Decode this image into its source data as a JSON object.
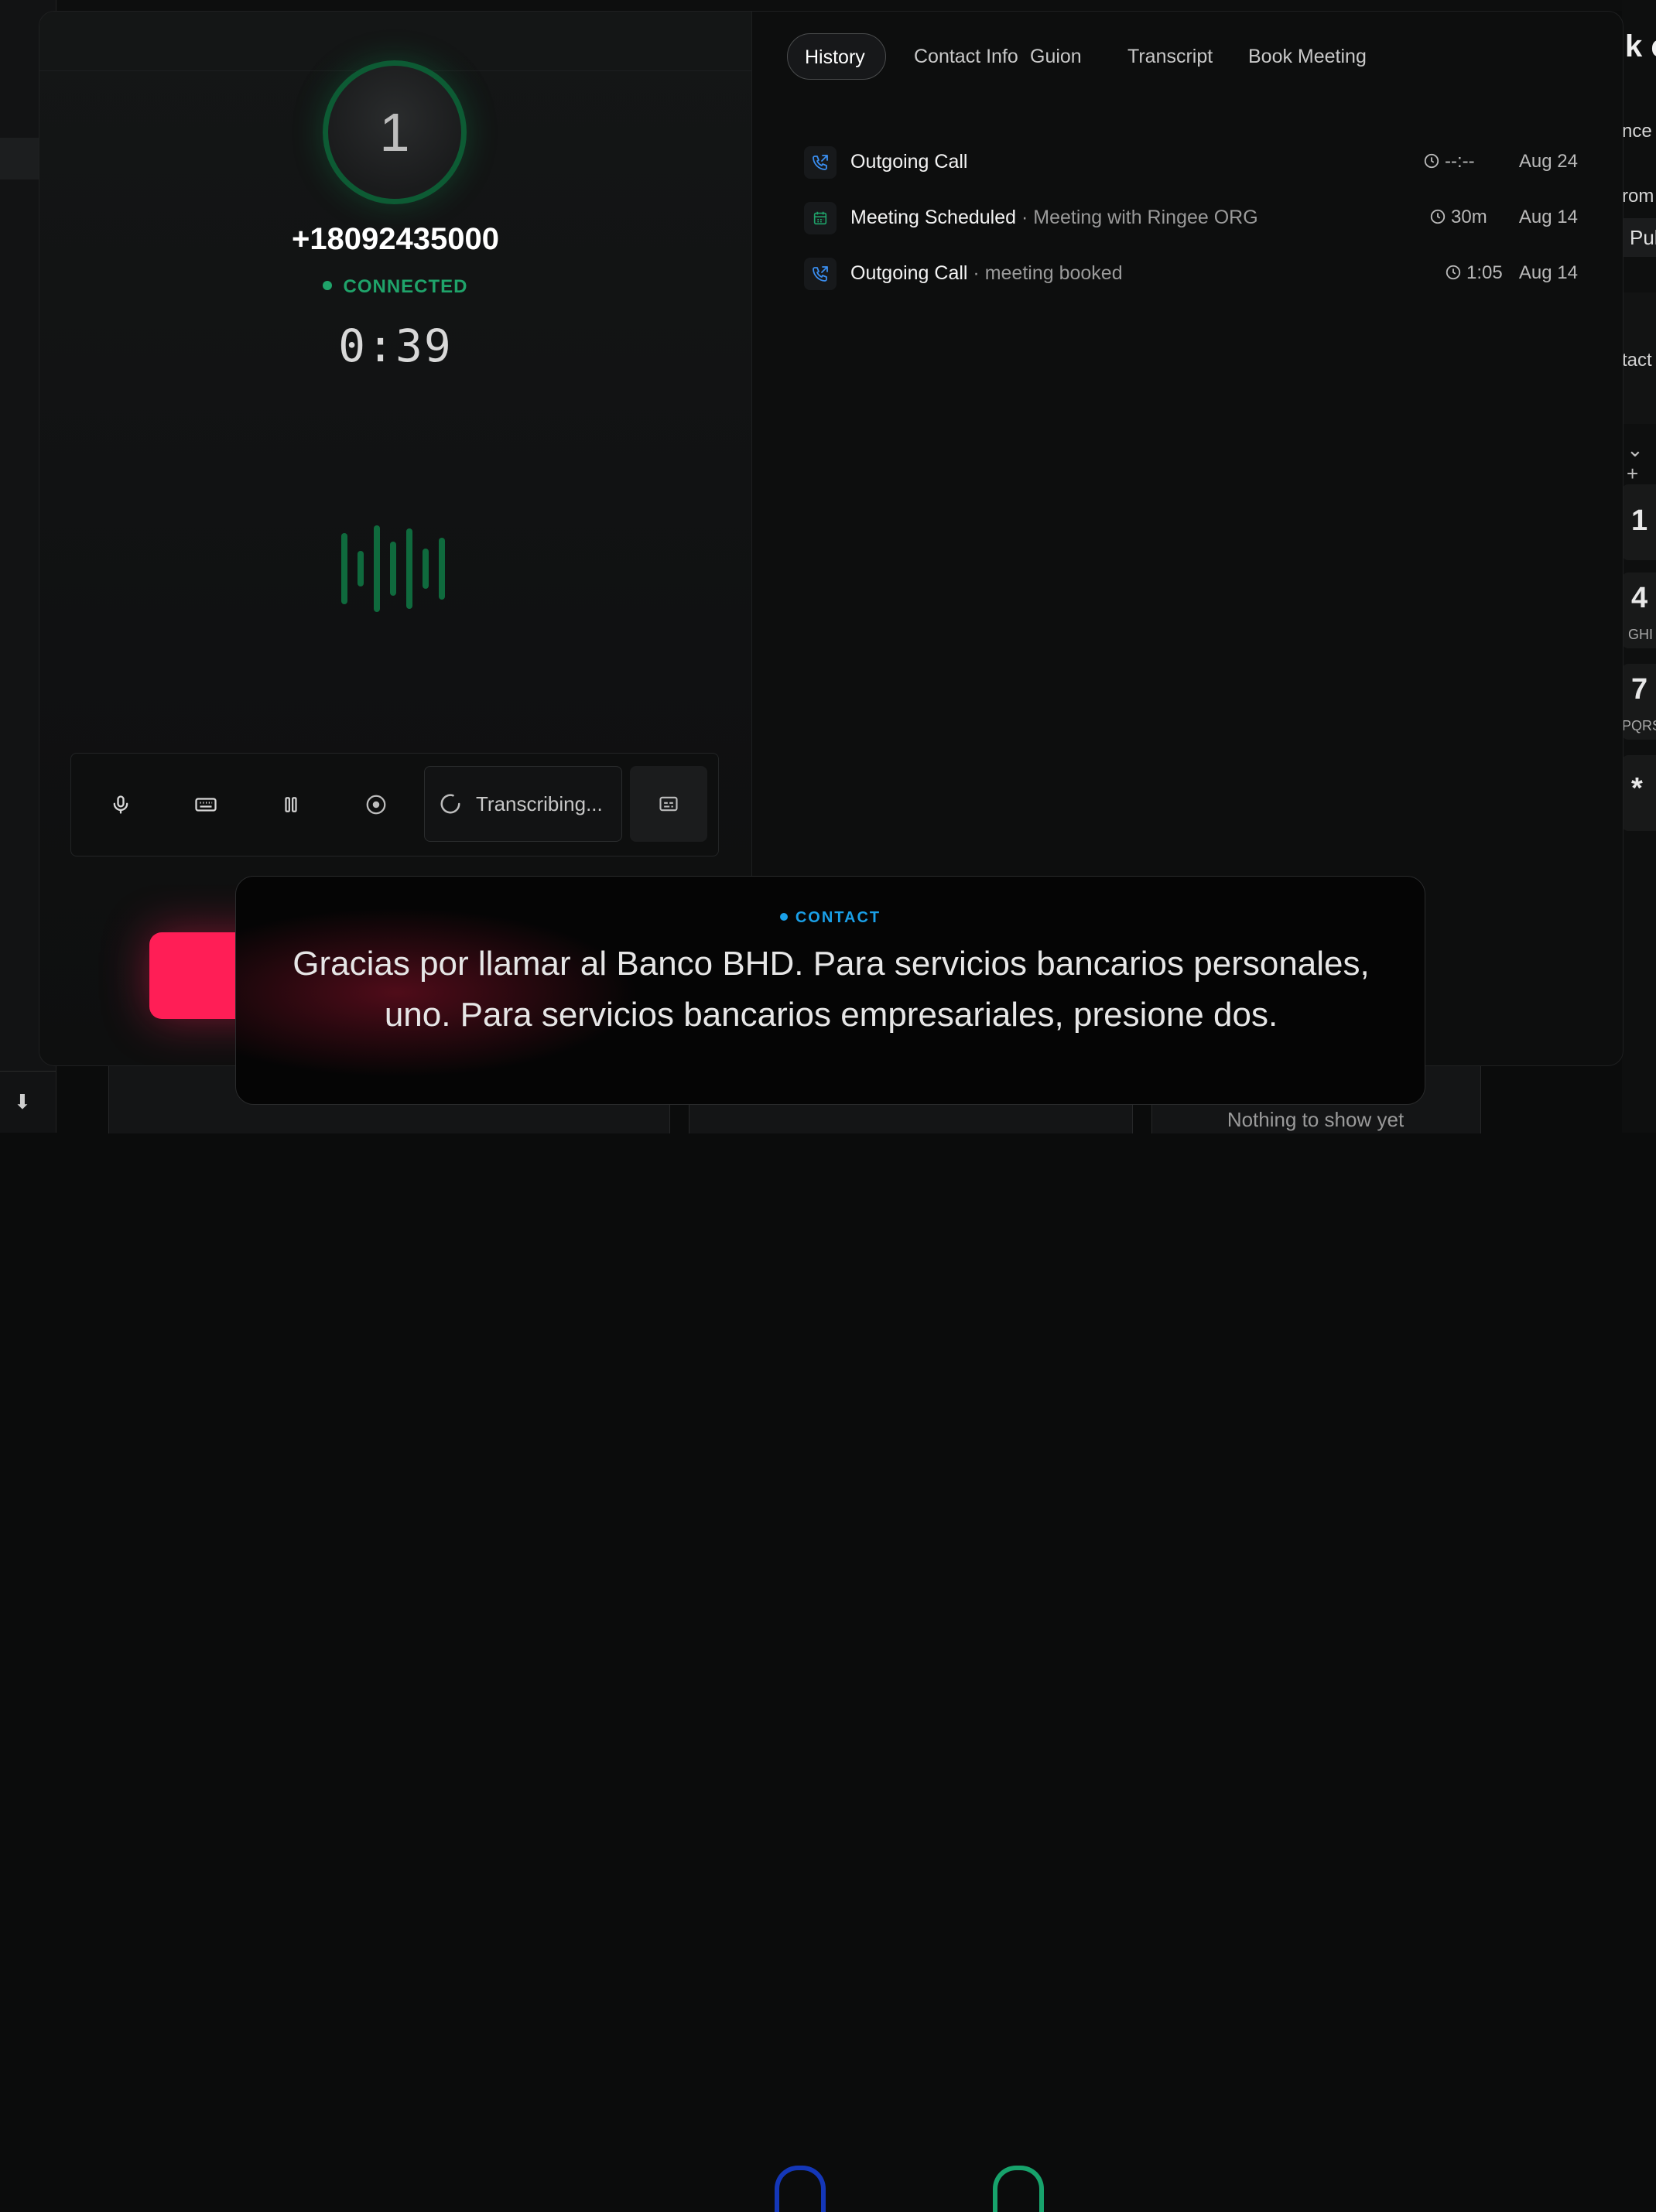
{
  "call": {
    "avatar_initial": "1",
    "phone_number": "+18092435000",
    "status": "CONNECTED",
    "timer": "0:39",
    "transcribing_label": "Transcribing..."
  },
  "tabs": [
    {
      "label": "History",
      "active": true
    },
    {
      "label": "Contact Info"
    },
    {
      "label": "Guion"
    },
    {
      "label": "Transcript"
    },
    {
      "label": "Book Meeting"
    }
  ],
  "history": [
    {
      "icon": "phone-outgoing-icon",
      "title": "Outgoing Call",
      "subtitle": "",
      "duration": "--:--",
      "date": "Aug 24"
    },
    {
      "icon": "calendar-icon",
      "title": "Meeting Scheduled",
      "subtitle": " · Meeting with Ringee ORG",
      "duration": "30m",
      "date": "Aug 14"
    },
    {
      "icon": "phone-outgoing-icon",
      "title": "Outgoing Call",
      "subtitle": " · meeting booked",
      "duration": "1:05",
      "date": "Aug 14"
    }
  ],
  "transcript_toast": {
    "label": "CONTACT",
    "message": "Gracias por llamar al Banco BHD. Para servicios bancarios personales, uno. Para servicios bancarios empresariales, presione dos."
  },
  "background": {
    "empty_state": "Nothing to show yet",
    "right_fragments": [
      "k c",
      "nce",
      "rom",
      "Pul",
      "tact",
      "1",
      "4",
      "GHI",
      "7",
      "PQRS",
      "*"
    ]
  },
  "colors": {
    "connected_green": "#1fa36a",
    "hangup_red": "#ff1e56",
    "contact_blue": "#1aa0e8"
  }
}
